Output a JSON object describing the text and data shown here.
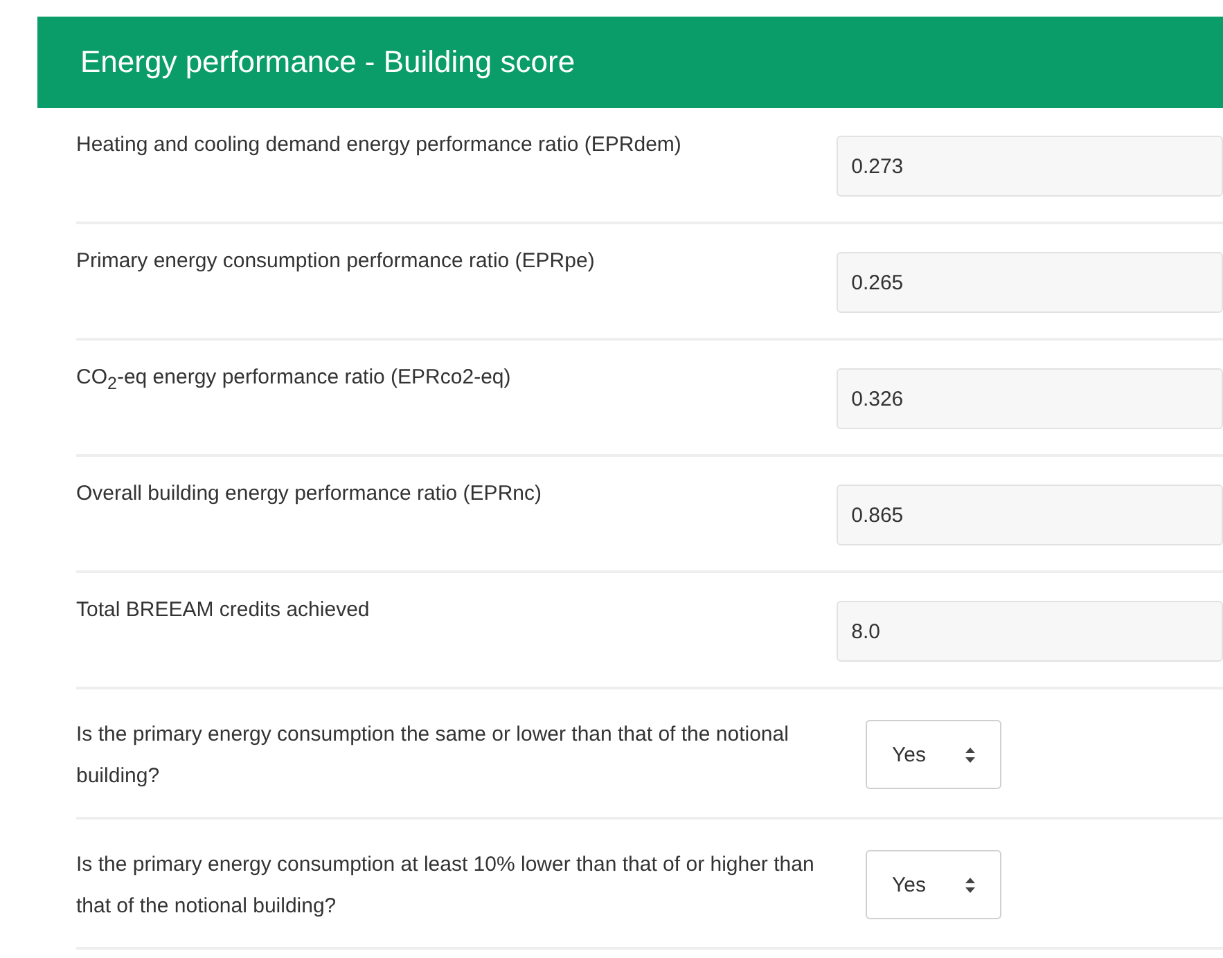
{
  "panel": {
    "title": "Energy performance - Building score"
  },
  "fields": [
    {
      "kind": "text",
      "label": "Heating and cooling demand energy performance ratio (EPRdem)",
      "value": "0.273"
    },
    {
      "kind": "text",
      "label": "Primary energy consumption performance ratio (EPRpe)",
      "value": "0.265"
    },
    {
      "kind": "text",
      "label": "CO$_{2}$-eq energy performance ratio (EPRco2-eq)",
      "value": "0.326"
    },
    {
      "kind": "text",
      "label": "Overall building energy performance ratio (EPRnc)",
      "value": "0.865"
    },
    {
      "kind": "text",
      "label": "Total BREEAM credits achieved",
      "value": "8.0"
    },
    {
      "kind": "select",
      "label": "Is the primary energy consumption the same or lower than that of the notional building?",
      "value": "Yes"
    },
    {
      "kind": "select",
      "label": "Is the primary energy consumption at least 10% lower than that of or higher than that of the notional building?",
      "value": "Yes"
    }
  ]
}
